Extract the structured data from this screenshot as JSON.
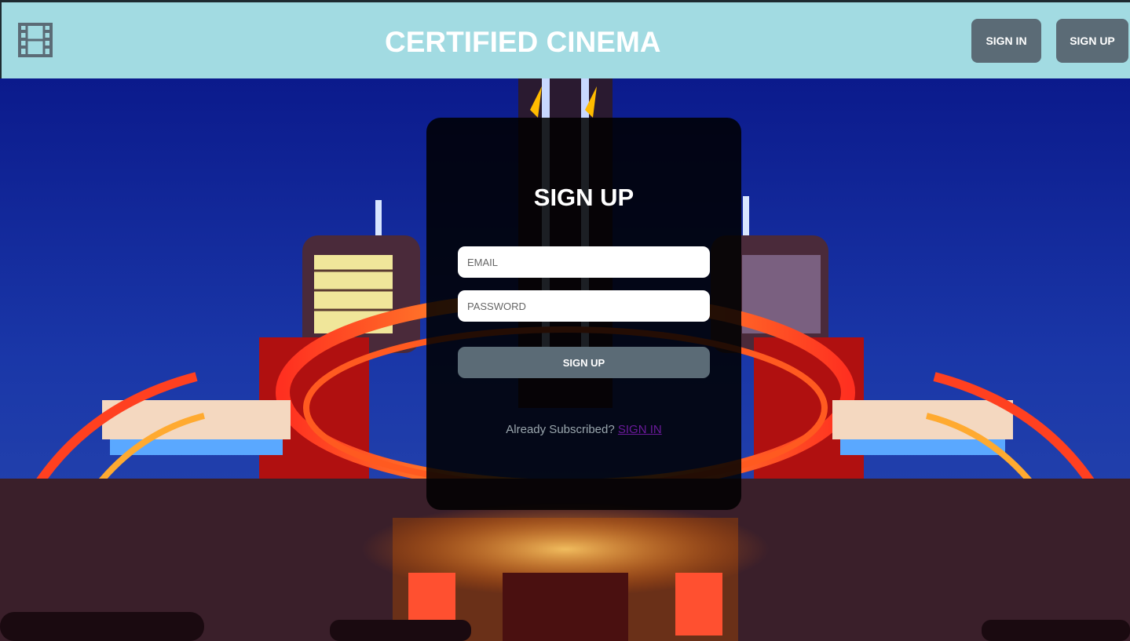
{
  "header": {
    "logo_icon": "film-icon",
    "title": "CERTIFIED CINEMA",
    "signin_label": "SIGN IN",
    "signup_label": "SIGN UP",
    "bg_color": "#a2dbe2",
    "button_color": "#5b6b76"
  },
  "form": {
    "title": "SIGN UP",
    "email_placeholder": "EMAIL",
    "password_placeholder": "PASSWORD",
    "submit_label": "SIGN UP",
    "already_text": "Already Subscribed?",
    "signin_link": "SIGN IN"
  }
}
